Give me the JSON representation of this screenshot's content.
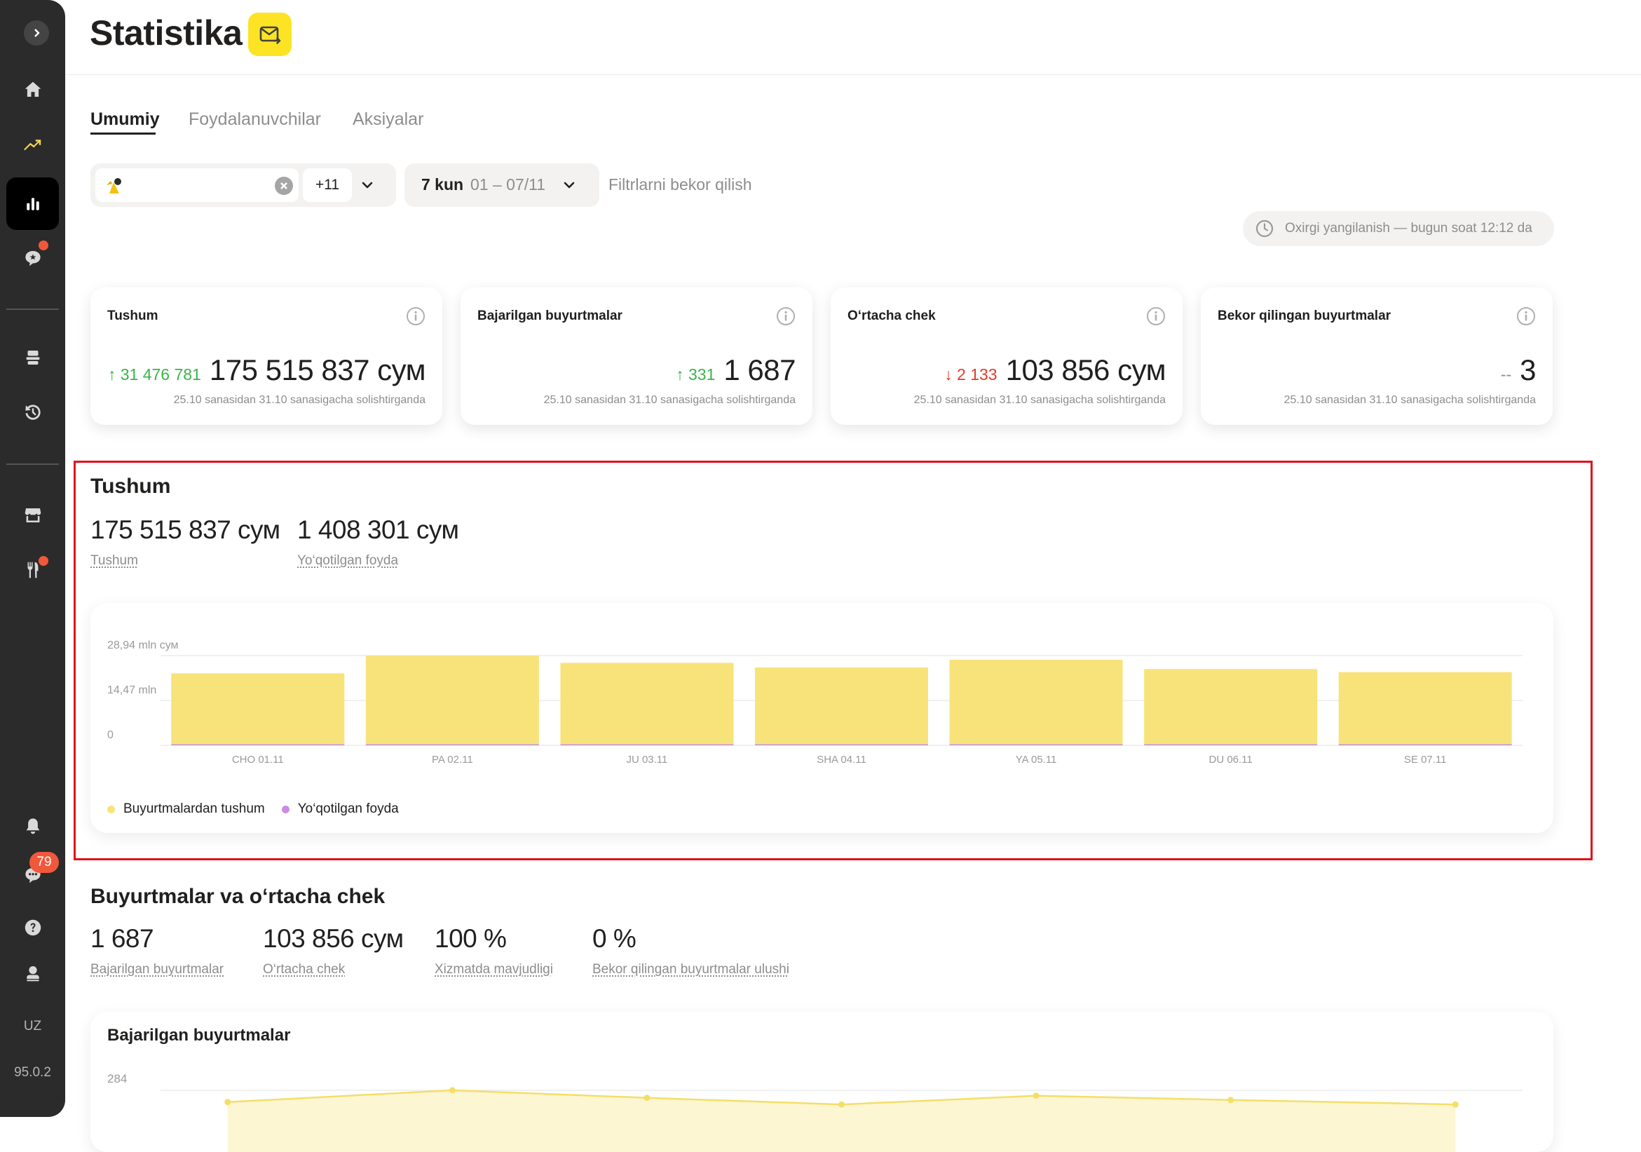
{
  "sidebar": {
    "lang": "UZ",
    "version": "95.0.2",
    "messages_badge": "79",
    "icons": [
      "chevron-right-icon",
      "home-icon",
      "trend-icon",
      "statistics-icon",
      "chat-star-icon",
      "tray-icon",
      "history-icon",
      "store-icon",
      "restaurant-icon",
      "bell-icon",
      "support-chat-icon",
      "help-icon",
      "profile-icon"
    ]
  },
  "header": {
    "title": "Statistika"
  },
  "tabs": [
    {
      "label": "Umumiy",
      "active": true
    },
    {
      "label": "Foydalanuvchilar",
      "active": false
    },
    {
      "label": "Aksiyalar",
      "active": false
    }
  ],
  "filters": {
    "places_more": "+11",
    "period_days": "7 kun",
    "period_range": "01 – 07/11",
    "reset": "Filtrlarni bekor qilish",
    "last_update": "Oxirgi yangilanish — bugun soat 12:12 da"
  },
  "kpis": [
    {
      "title": "Tushum",
      "delta": "↑ 31 476 781",
      "trend": "up",
      "value": "175 515 837 сум",
      "compare": "25.10 sanasidan 31.10 sanasigacha solishtirganda"
    },
    {
      "title": "Bajarilgan buyurtmalar",
      "delta": "↑ 331",
      "trend": "up",
      "value": "1 687",
      "compare": "25.10 sanasidan 31.10 sanasigacha solishtirganda"
    },
    {
      "title": "O‘rtacha chek",
      "delta": "↓ 2 133",
      "trend": "down",
      "value": "103 856 сум",
      "compare": "25.10 sanasidan 31.10 sanasigacha solishtirganda"
    },
    {
      "title": "Bekor qilingan buyurtmalar",
      "delta": "--",
      "trend": "neutral",
      "value": "3",
      "compare": "25.10 sanasidan 31.10 sanasigacha solishtirganda"
    }
  ],
  "revenue": {
    "title": "Tushum",
    "metrics": [
      {
        "value": "175 515 837 сум",
        "label": "Tushum"
      },
      {
        "value": "1 408 301 сум",
        "label": "Yo‘qotilgan foyda"
      }
    ]
  },
  "orders": {
    "title": "Buyurtmalar va o‘rtacha chek",
    "metrics": [
      {
        "value": "1 687",
        "label": "Bajarilgan buyurtmalar"
      },
      {
        "value": "103 856 сум",
        "label": "O‘rtacha chek"
      },
      {
        "value": "100 %",
        "label": "Xizmatda mavjudligi"
      },
      {
        "value": "0 %",
        "label": "Bekor qilingan buyurtmalar ulushi"
      }
    ],
    "line_chart_title": "Bajarilgan buyurtmalar"
  },
  "colors": {
    "accent_yellow": "#f8e37a",
    "lost_purple": "#c98de6",
    "up_green": "#3bb44a",
    "down_red": "#e23b2b",
    "highlight_red": "#e0101c"
  },
  "chart_data": [
    {
      "type": "bar",
      "categories": [
        "CHO 01.11",
        "PA 02.11",
        "JU 03.11",
        "SHA 04.11",
        "YA 05.11",
        "DU 06.11",
        "SE 07.11"
      ],
      "series": [
        {
          "name": "Buyurtmalardan tushum",
          "values": [
            23.2,
            28.9,
            26.6,
            25.1,
            27.6,
            24.6,
            23.6
          ]
        },
        {
          "name": "Yo‘qotilgan foyda",
          "values": [
            0.2,
            0.2,
            0.2,
            0.2,
            0.2,
            0.2,
            0.2
          ]
        }
      ],
      "ytick_labels": [
        "0",
        "14,47 mln",
        "28,94 mln сум"
      ],
      "yticks": [
        0,
        14.47,
        28.94
      ],
      "ylim": [
        0,
        28.94
      ],
      "legend": "bottom-left",
      "grid": true
    },
    {
      "type": "line",
      "title": "Bajarilgan buyurtmalar",
      "ytick_labels": [
        "284"
      ],
      "yticks": [
        284
      ],
      "values": [
        245,
        284,
        259,
        237,
        266,
        252,
        237
      ],
      "grid": true
    }
  ]
}
